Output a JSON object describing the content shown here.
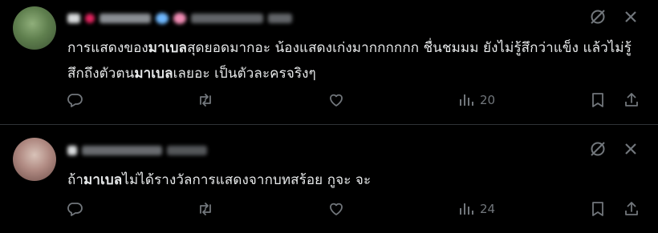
{
  "posts": [
    {
      "text_pre": "การแสดงของ",
      "text_hl1": "มาเบล",
      "text_mid": "สุดยอดมากอะ น้องแสดงเก่งมากกกกกก ชื่นชมมม ยังไม่รู้สึกว่าแข็ง แล้วไม่รู้สึกถึงตัวตน",
      "text_hl2": "มาเบล",
      "text_post": "เลยอะ เป็นตัวละครจริงๆ",
      "views": "20"
    },
    {
      "text_pre": "ถ้า",
      "text_hl1": "มาเบล",
      "text_mid": "ไม่ได้รางวัลการแสดงจากบทสร้อย กูจะ จะ",
      "text_hl2": "",
      "text_post": "",
      "views": "24"
    }
  ],
  "icons": {
    "header": [
      "grok-icon",
      "more-icon"
    ],
    "actions": [
      "reply-icon",
      "repost-icon",
      "like-icon",
      "views-icon",
      "bookmark-icon",
      "share-icon"
    ]
  },
  "colors": {
    "background": "#000000",
    "text": "#e7e9ea",
    "muted": "#71767b",
    "divider": "#2f3336"
  }
}
